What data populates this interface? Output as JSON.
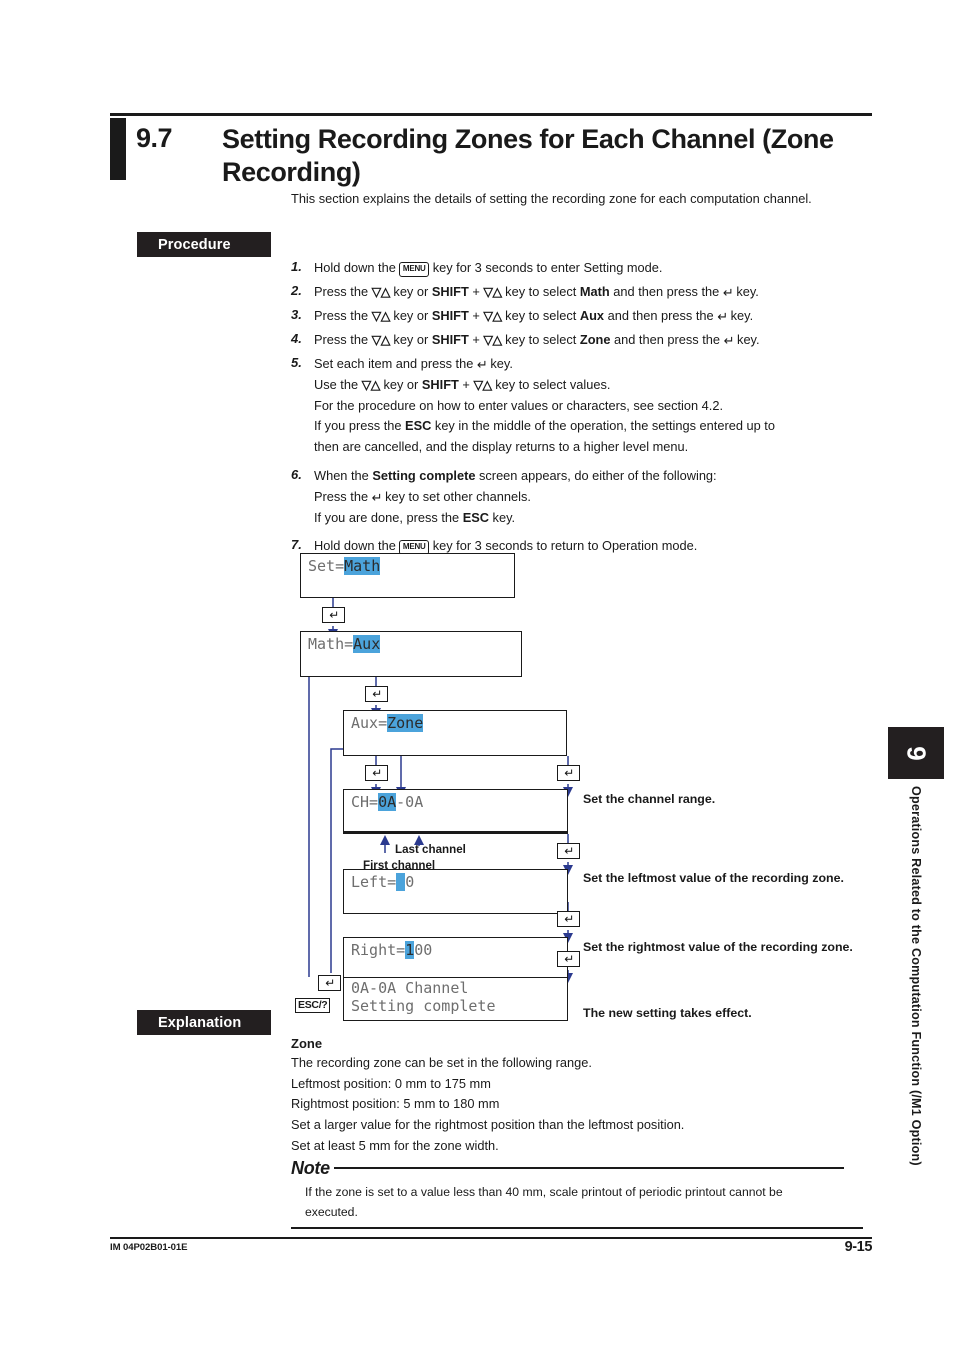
{
  "section": {
    "number": "9.7",
    "title": "Setting Recording Zones for Each Channel (Zone Recording)",
    "intro": "This section explains the details of setting the recording zone for each computation channel."
  },
  "tags": {
    "procedure": "Procedure",
    "explanation": "Explanation"
  },
  "steps": [
    {
      "n": "1.",
      "lines": [
        {
          "parts": [
            {
              "t": "Hold down the "
            },
            {
              "t": "MENU",
              "style": "key-menu"
            },
            {
              "t": " key for 3 seconds to enter Setting mode."
            }
          ]
        }
      ]
    },
    {
      "n": "2.",
      "lines": [
        {
          "parts": [
            {
              "t": "Press the "
            },
            {
              "t": "▽△",
              "style": "key-updown"
            },
            {
              "t": " key or "
            },
            {
              "t": "SHIFT",
              "style": "bold"
            },
            {
              "t": " + "
            },
            {
              "t": "▽△",
              "style": "key-updown"
            },
            {
              "t": " key to select "
            },
            {
              "t": "Math",
              "style": "bold"
            },
            {
              "t": " and then press the "
            },
            {
              "t": "↵",
              "style": "key-enter"
            },
            {
              "t": " key."
            }
          ]
        }
      ]
    },
    {
      "n": "3.",
      "lines": [
        {
          "parts": [
            {
              "t": "Press the "
            },
            {
              "t": "▽△",
              "style": "key-updown"
            },
            {
              "t": " key or "
            },
            {
              "t": "SHIFT",
              "style": "bold"
            },
            {
              "t": " + "
            },
            {
              "t": "▽△",
              "style": "key-updown"
            },
            {
              "t": " key to select "
            },
            {
              "t": "Aux",
              "style": "bold"
            },
            {
              "t": " and then press the "
            },
            {
              "t": "↵",
              "style": "key-enter"
            },
            {
              "t": " key."
            }
          ]
        }
      ]
    },
    {
      "n": "4.",
      "lines": [
        {
          "parts": [
            {
              "t": "Press the "
            },
            {
              "t": "▽△",
              "style": "key-updown"
            },
            {
              "t": " key or "
            },
            {
              "t": "SHIFT",
              "style": "bold"
            },
            {
              "t": " + "
            },
            {
              "t": "▽△",
              "style": "key-updown"
            },
            {
              "t": " key to select "
            },
            {
              "t": "Zone",
              "style": "bold"
            },
            {
              "t": " and then press the "
            },
            {
              "t": "↵",
              "style": "key-enter"
            },
            {
              "t": " key."
            }
          ]
        }
      ]
    },
    {
      "n": "5.",
      "lines": [
        {
          "parts": [
            {
              "t": "Set each item and press the "
            },
            {
              "t": "↵",
              "style": "key-enter"
            },
            {
              "t": " key."
            }
          ]
        },
        {
          "parts": [
            {
              "t": "Use the "
            },
            {
              "t": "▽△",
              "style": "key-updown"
            },
            {
              "t": " key or "
            },
            {
              "t": "SHIFT",
              "style": "bold"
            },
            {
              "t": " + "
            },
            {
              "t": "▽△",
              "style": "key-updown"
            },
            {
              "t": " key to select values."
            }
          ]
        },
        {
          "parts": [
            {
              "t": "For the procedure on how to enter values or characters, see section 4.2."
            }
          ]
        },
        {
          "parts": [
            {
              "t": "If you press the "
            },
            {
              "t": "ESC",
              "style": "bold"
            },
            {
              "t": " key in the middle of the operation, the settings entered up to"
            }
          ]
        },
        {
          "parts": [
            {
              "t": "then are cancelled, and the display returns to a higher level menu."
            }
          ]
        }
      ]
    },
    {
      "n": "6.",
      "lines": [
        {
          "parts": [
            {
              "t": "When the "
            },
            {
              "t": "Setting complete",
              "style": "bold"
            },
            {
              "t": " screen appears, do either of the following:"
            }
          ]
        },
        {
          "parts": [
            {
              "t": "Press the "
            },
            {
              "t": "↵",
              "style": "key-enter"
            },
            {
              "t": " key to set other channels."
            }
          ]
        },
        {
          "parts": [
            {
              "t": "If you are done, press the "
            },
            {
              "t": "ESC",
              "style": "bold"
            },
            {
              "t": " key."
            }
          ]
        }
      ]
    },
    {
      "n": "7.",
      "lines": [
        {
          "parts": [
            {
              "t": "Hold down the "
            },
            {
              "t": "MENU",
              "style": "key-menu"
            },
            {
              "t": " key for 3 seconds to return to Operation mode."
            }
          ]
        }
      ]
    }
  ],
  "flow": {
    "enter_key_glyph": "↵",
    "esc_label": "ESC/?",
    "screens": [
      {
        "id": "set",
        "prefix": "Set=",
        "highlight": "Math",
        "suffix": ""
      },
      {
        "id": "math",
        "prefix": "Math=",
        "highlight": "Aux",
        "suffix": ""
      },
      {
        "id": "aux",
        "prefix": "Aux=",
        "highlight": "Zone",
        "suffix": ""
      },
      {
        "id": "ch",
        "prefix": "CH=",
        "highlight": "0A",
        "suffix": "-0A"
      },
      {
        "id": "left",
        "prefix": "Left=",
        "highlight": " ",
        "suffix": " 0"
      },
      {
        "id": "right",
        "prefix": "Right=",
        "highlight": "1",
        "suffix": "00"
      }
    ],
    "complete_screen": {
      "line1": "0A-0A Channel",
      "line2": "Setting complete"
    },
    "callouts": {
      "first_channel": "First channel",
      "last_channel": "Last channel"
    },
    "annotations": [
      "Set the channel range.",
      "Set the leftmost value of the recording zone.",
      "Set the rightmost value of the recording zone.",
      "The new setting takes effect."
    ],
    "highlight_color": "#4ba3db",
    "line_color": "#2b3a8f"
  },
  "explanation": {
    "heading": "Zone",
    "lines": [
      "The recording zone can be set in the following range.",
      "Leftmost position: 0 mm to 175 mm",
      "Rightmost position: 5 mm to 180 mm",
      "Set a larger value for the rightmost position than the leftmost position.",
      "Set at least 5 mm for the zone width."
    ]
  },
  "note": {
    "title": "Note",
    "lines": [
      "If the zone is set to a value less than 40 mm, scale printout of periodic printout cannot be",
      "executed."
    ]
  },
  "chapter_tab": {
    "number": "9",
    "label": "Operations Related to the Computation Function (/M1 Option)"
  },
  "footer": {
    "manual_code": "IM 04P02B01-01E",
    "page": "9-15"
  }
}
